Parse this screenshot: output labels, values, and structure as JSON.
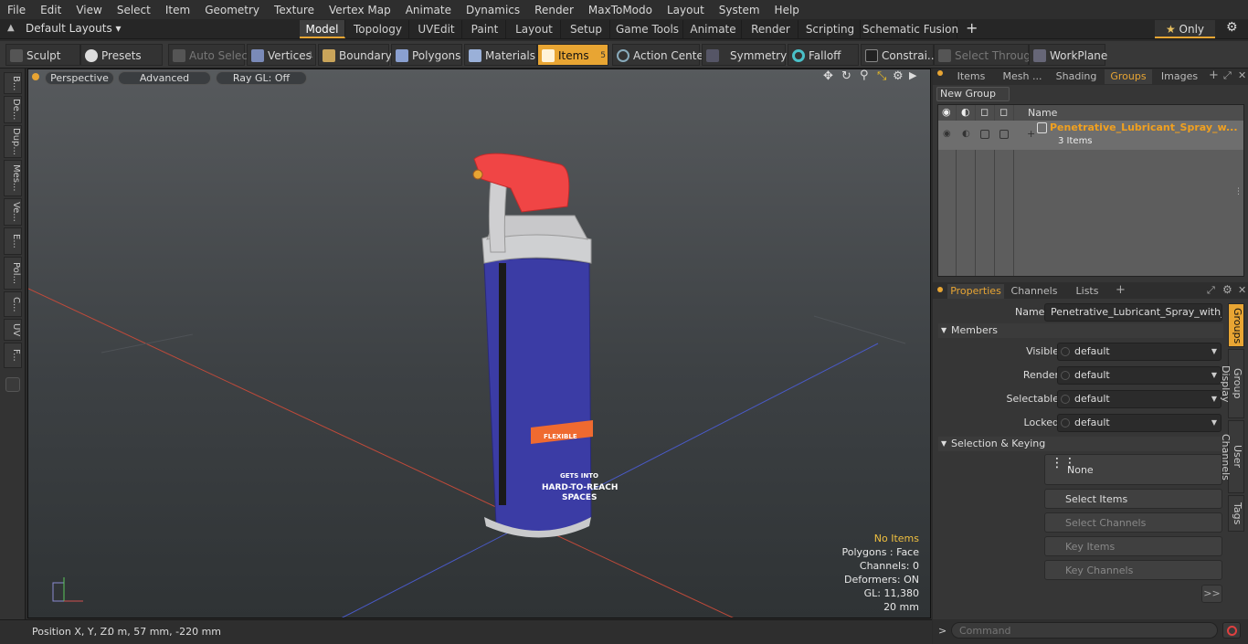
{
  "menu": [
    "File",
    "Edit",
    "View",
    "Select",
    "Item",
    "Geometry",
    "Texture",
    "Vertex Map",
    "Animate",
    "Dynamics",
    "Render",
    "MaxToModo",
    "Layout",
    "System",
    "Help"
  ],
  "layouts_label": "Default Layouts",
  "top_tabs": [
    "Model",
    "Topology",
    "UVEdit",
    "Paint",
    "Layout",
    "Setup",
    "Game Tools",
    "Animate",
    "Render",
    "Scripting",
    "Schematic Fusion"
  ],
  "only_label": "Only",
  "toolbar": {
    "sculpt": "Sculpt",
    "presets": "Presets",
    "auto_select": "Auto Select",
    "vertices": "Vertices",
    "vertices_count": "1",
    "boundary": "Boundary",
    "polygons": "Polygons",
    "materials": "Materials",
    "items": "Items",
    "items_count": "5",
    "action_center": "Action Center",
    "symmetry": "Symmetry",
    "falloff": "Falloff",
    "constraints": "Constrai...",
    "select_through": "Select Through",
    "workplane": "WorkPlane"
  },
  "left_tabs": [
    "B...",
    "De...",
    "Dup...",
    "Mes...",
    "Ve...",
    "E...",
    "Pol...",
    "C...",
    "UV",
    "F..."
  ],
  "viewport": {
    "perspective": "Perspective",
    "advanced": "Advanced",
    "raygl": "Ray GL: Off",
    "can_label_1": "FLEXIBLE",
    "can_label_2": "GETS INTO",
    "can_label_3": "HARD-TO-REACH",
    "can_label_4": "SPACES",
    "stats": {
      "no_items": "No Items",
      "polygons": "Polygons : Face",
      "channels": "Channels: 0",
      "deformers": "Deformers: ON",
      "gl": "GL: 11,380",
      "unit": "20 mm"
    }
  },
  "status": {
    "position_label": "Position X, Y, Z:",
    "position_value": "0 m, 57 mm, -220 mm"
  },
  "right_tabs": [
    "Items",
    "Mesh ...",
    "Shading",
    "Groups",
    "Images"
  ],
  "new_group": "New Group",
  "groups_table": {
    "name_header": "Name",
    "group_name": "Penetrative_Lubricant_Spray_w...",
    "group_count": "3 Items"
  },
  "prop_tabs": [
    "Properties",
    "Channels",
    "Lists"
  ],
  "properties": {
    "name_label": "Name",
    "name_value": "Penetrative_Lubricant_Spray_with_Fle",
    "members": "Members",
    "visible_label": "Visible",
    "render_label": "Render",
    "selectable_label": "Selectable",
    "locked_label": "Locked",
    "dropdown_value": "default",
    "selection_keying": "Selection & Keying",
    "none": "None",
    "select_items": "Select Items",
    "select_channels": "Select Channels",
    "key_items": "Key Items",
    "key_channels": "Key Channels",
    "more": ">>"
  },
  "vertical_tabs": [
    "Groups",
    "Group Display",
    "User Channels",
    "Tags"
  ],
  "command_placeholder": "Command",
  "colors": {
    "accent": "#e8a533",
    "can_blue": "#3a3aa0",
    "cap_red": "#f04545"
  }
}
